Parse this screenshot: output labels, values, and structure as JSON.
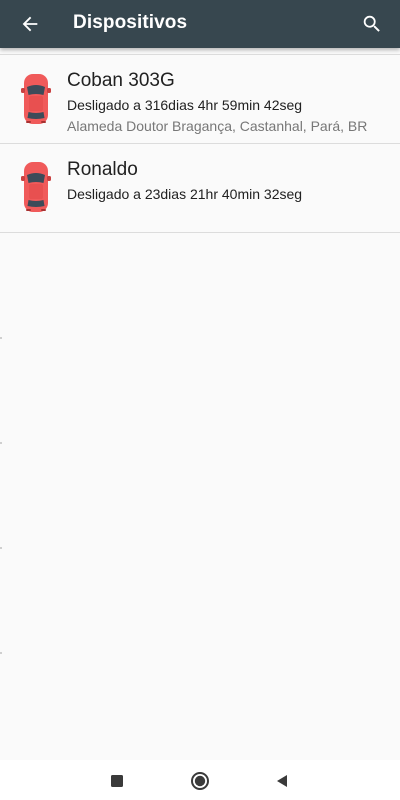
{
  "app": {
    "title": "Dispositivos"
  },
  "toolbar": {
    "back_icon": "arrow-back-icon",
    "search_icon": "search-icon"
  },
  "devices": [
    {
      "name": "Coban 303G",
      "status": "Desligado a 316dias 4hr 59min 42seg",
      "address": "Alameda Doutor Bragança, Castanhal, Pará, BR",
      "icon": "car-icon"
    },
    {
      "name": "Ronaldo",
      "status": "Desligado a 23dias 21hr 40min 32seg",
      "icon": "car-icon"
    }
  ],
  "system_nav": {
    "recents_icon": "recents-square-icon",
    "home_icon": "home-circle-icon",
    "back_icon": "back-triangle-icon"
  },
  "colors": {
    "appbar": "#37474f",
    "car_body": "#f05a5a",
    "divider": "#dcdcdc",
    "background": "#fafafa"
  }
}
